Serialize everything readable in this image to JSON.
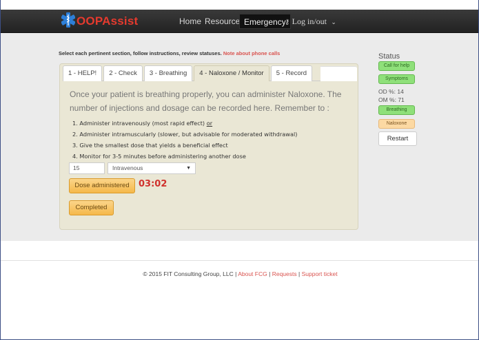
{
  "navbar": {
    "brand": "OOPAssist",
    "links": [
      "Home",
      "Resources",
      "Emergency"
    ],
    "login": "Log in/out"
  },
  "instructions": {
    "text": "Select each pertinent section, follow instructions, review statuses.",
    "note": "Note about phone calls"
  },
  "tabs": [
    "1 - HELP!",
    "2 - Check",
    "3 - Breathing",
    "4 - Naloxone / Monitor",
    "5 - Record"
  ],
  "active_tab": "4 - Naloxone / Monitor",
  "lead": "Once your patient is breathing properly, you can administer Naloxone. The number of injections and dosage can be recorded here. Remember to :",
  "steps": [
    "1.  Administer intravenously (most rapid effect)",
    "2.  Administer intramuscularly (slower, but advisable for moderated withdrawal)",
    "3.  Give the smallest dose that yields a beneficial effect",
    "4.  Monitor for 3-5 minutes before administering another dose"
  ],
  "step1_or": "or",
  "dose": {
    "value": "15",
    "route": "Intravenous"
  },
  "buttons": {
    "dose": "Dose administered",
    "completed": "Completed",
    "restart": "Restart"
  },
  "timer": "03:02",
  "status": {
    "title": "Status",
    "call": "Call for help",
    "symptoms": "Symptoms",
    "od": "OD %: 14",
    "om": "OM %: 71",
    "breathing": "Breathing",
    "naloxone": "Naloxone"
  },
  "colors": {
    "brand": "#e53a2e",
    "status_done": "#8fe07a",
    "status_pending": "#fcd9a3",
    "accent": "#f5b84a"
  },
  "footer": {
    "copyright": "© 2015 FIT Consulting Group, LLC |",
    "about": "About FCG",
    "sep1": "|",
    "requests": "Requests",
    "sep2": "|",
    "support": "Support ticket"
  }
}
